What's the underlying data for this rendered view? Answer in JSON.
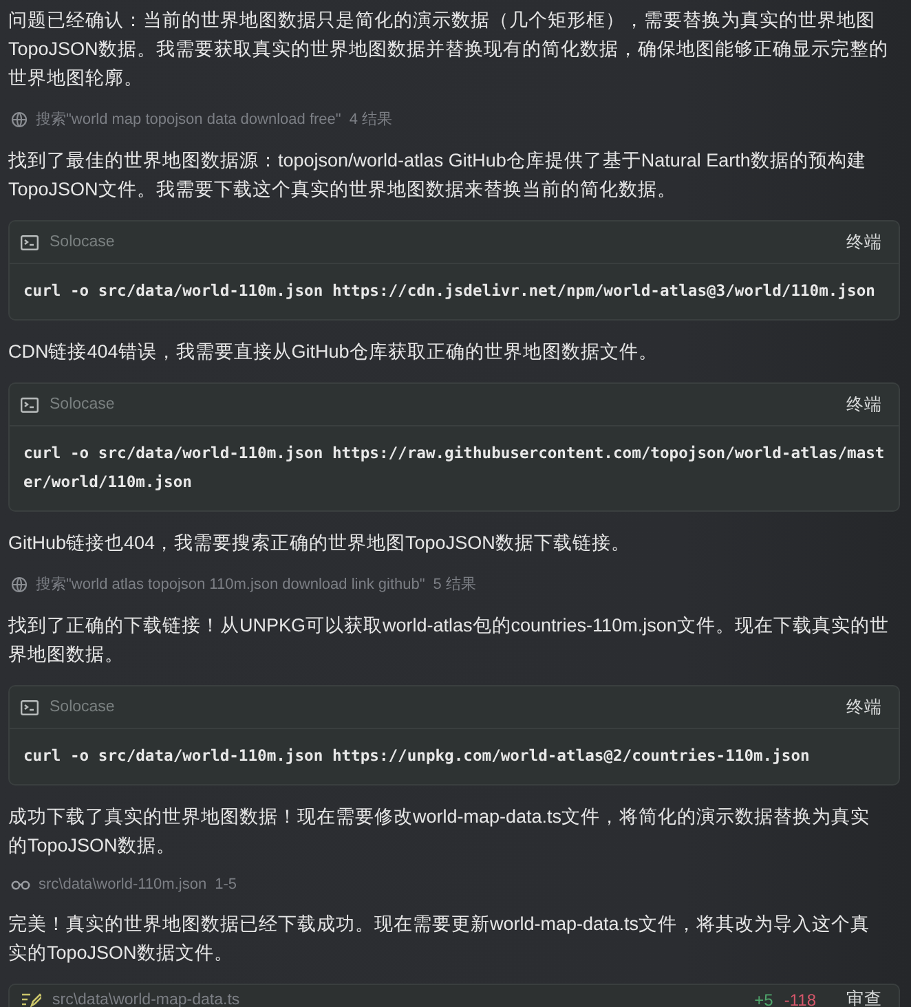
{
  "blocks": [
    {
      "kind": "text",
      "text": "问题已经确认：当前的世界地图数据只是简化的演示数据（几个矩形框），需要替换为真实的世界地图TopoJSON数据。我需要获取真实的世界地图数据并替换现有的简化数据，确保地图能够正确显示完整的世界地图轮廓。"
    },
    {
      "kind": "search",
      "text": "搜索\"world map topojson data download free\"",
      "count": "4 结果"
    },
    {
      "kind": "text",
      "text": "找到了最佳的世界地图数据源：topojson/world-atlas GitHub仓库提供了基于Natural Earth数据的预构建TopoJSON文件。我需要下载这个真实的世界地图数据来替换当前的简化数据。"
    },
    {
      "kind": "terminal",
      "app": "Solocase",
      "action": "终端",
      "command": "curl -o src/data/world-110m.json https://cdn.jsdelivr.net/npm/world-atlas@3/world/110m.json"
    },
    {
      "kind": "text",
      "text": "CDN链接404错误，我需要直接从GitHub仓库获取正确的世界地图数据文件。"
    },
    {
      "kind": "terminal",
      "app": "Solocase",
      "action": "终端",
      "command": "curl -o src/data/world-110m.json https://raw.githubusercontent.com/topojson/world-atlas/master/world/110m.json"
    },
    {
      "kind": "text",
      "text": "GitHub链接也404，我需要搜索正确的世界地图TopoJSON数据下载链接。"
    },
    {
      "kind": "search",
      "text": "搜索\"world atlas topojson 110m.json download link github\"",
      "count": "5 结果"
    },
    {
      "kind": "text",
      "text": "找到了正确的下载链接！从UNPKG可以获取world-atlas包的countries-110m.json文件。现在下载真实的世界地图数据。"
    },
    {
      "kind": "terminal",
      "app": "Solocase",
      "action": "终端",
      "command": "curl -o src/data/world-110m.json https://unpkg.com/world-atlas@2/countries-110m.json"
    },
    {
      "kind": "text",
      "text": "成功下载了真实的世界地图数据！现在需要修改world-map-data.ts文件，将简化的演示数据替换为真实的TopoJSON数据。"
    },
    {
      "kind": "file_read",
      "path": "src\\data\\world-110m.json",
      "range": "1-5"
    },
    {
      "kind": "text",
      "text": "完美！真实的世界地图数据已经下载成功。现在需要更新world-map-data.ts文件，将其改为导入这个真实的TopoJSON数据文件。"
    },
    {
      "kind": "file_edit",
      "path": "src\\data\\world-map-data.ts",
      "added": "+5",
      "removed": "-118",
      "action": "审查"
    }
  ]
}
